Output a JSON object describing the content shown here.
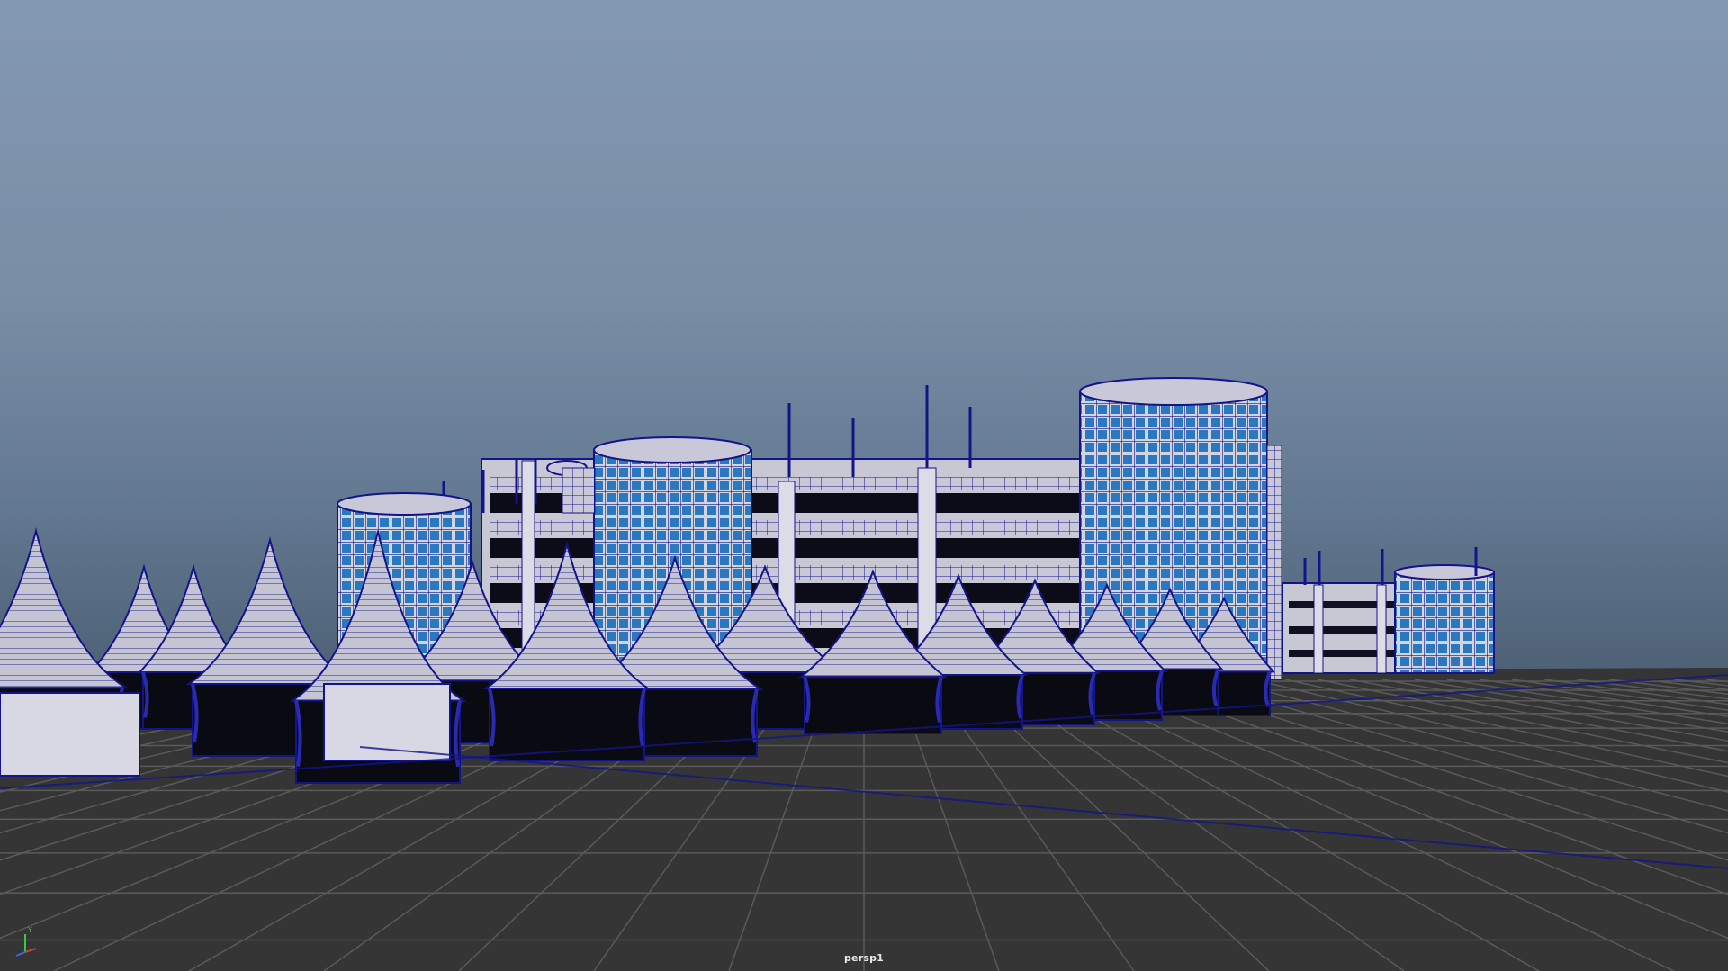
{
  "viewport": {
    "camera_name": "persp1",
    "sky_top_color": "#8398b1",
    "sky_bottom_color": "#4d6075",
    "ground_color": "#353535",
    "grid_color": "#5a5a5a",
    "wireframe_color": "#14148a",
    "surface_color": "#c8c8d8",
    "window_color": "#2a78c0"
  },
  "axis_gizmo": {
    "y_label": "Y",
    "colors": {
      "x": "#d23c3c",
      "y": "#3cc83c",
      "z": "#3c64e6"
    }
  }
}
